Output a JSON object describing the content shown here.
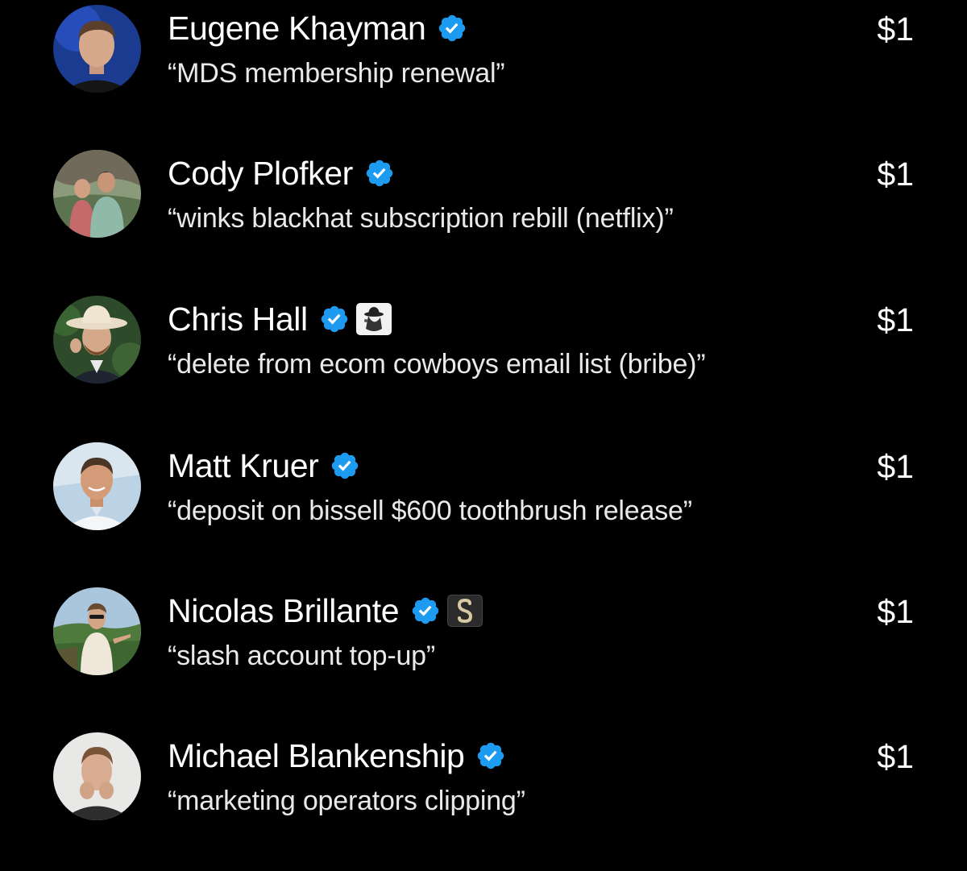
{
  "tips": [
    {
      "name": "Eugene Khayman",
      "verified": true,
      "affiliate_badge": null,
      "note": "“MDS membership renewal”",
      "amount": "$1"
    },
    {
      "name": "Cody Plofker",
      "verified": true,
      "affiliate_badge": null,
      "note": "“winks blackhat subscription rebill (netflix)”",
      "amount": "$1"
    },
    {
      "name": "Chris Hall",
      "verified": true,
      "affiliate_badge": "cowboy-logo",
      "note": "“delete from ecom cowboys email list (bribe)”",
      "amount": "$1"
    },
    {
      "name": "Matt Kruer",
      "verified": true,
      "affiliate_badge": null,
      "note": "“deposit on bissell $600 toothbrush release”",
      "amount": "$1"
    },
    {
      "name": "Nicolas Brillante",
      "verified": true,
      "affiliate_badge": "s-logo",
      "note": "“slash account top-up”",
      "amount": "$1"
    },
    {
      "name": "Michael Blankenship",
      "verified": true,
      "affiliate_badge": null,
      "note": "“marketing operators clipping”",
      "amount": "$1"
    }
  ],
  "colors": {
    "background": "#000000",
    "text": "#ffffff",
    "note_text": "#e7e9ea",
    "verified_badge": "#1d9bf0"
  }
}
